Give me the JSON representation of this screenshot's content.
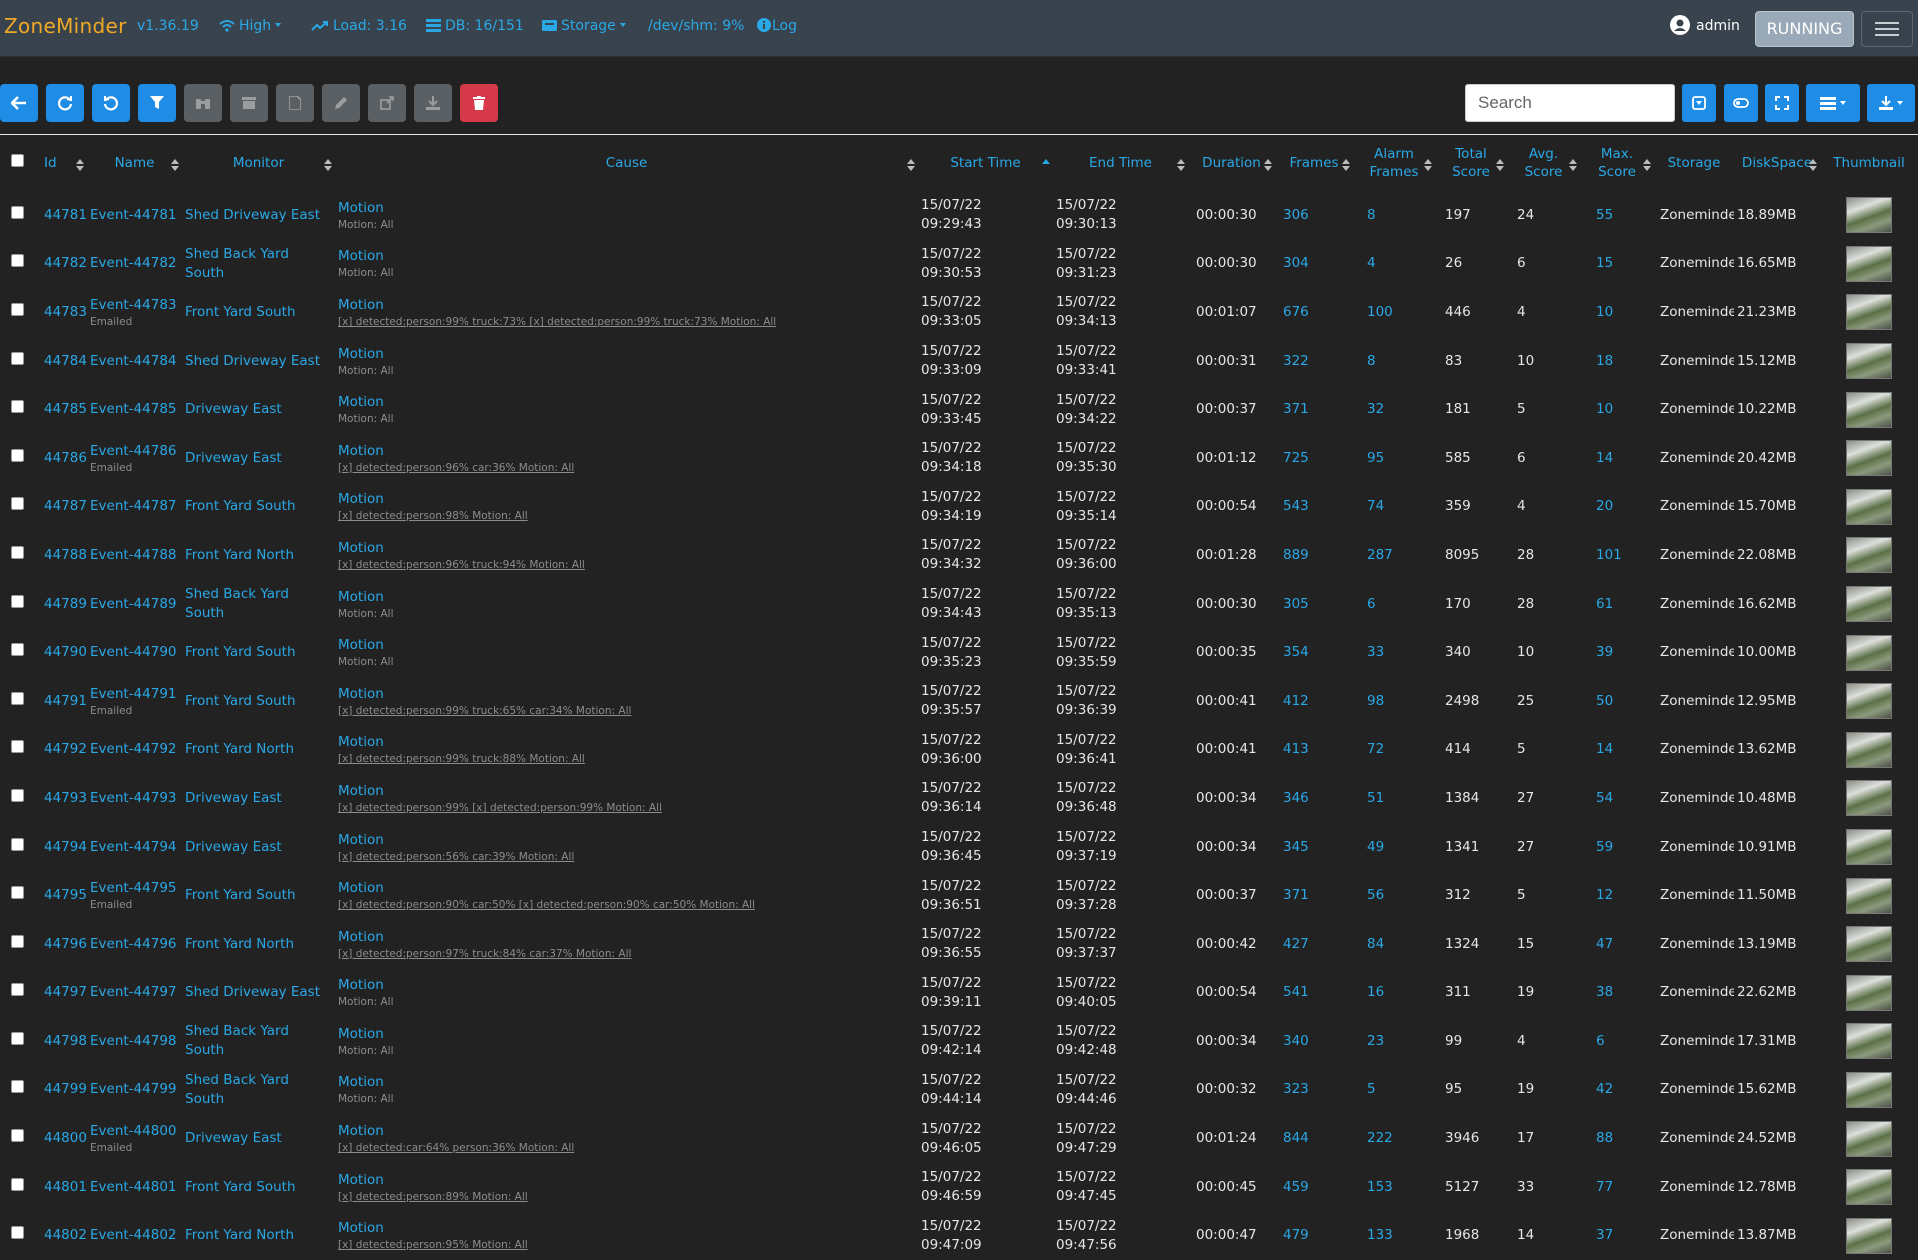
{
  "header": {
    "brand": "ZoneMinder",
    "version": "v1.36.19",
    "bandwidth": "High",
    "load": "Load: 3.16",
    "db": "DB: 16/151",
    "storage": "Storage",
    "shm": "/dev/shm: 9%",
    "log": "Log",
    "user": "admin",
    "state": "RUNNING"
  },
  "search": {
    "placeholder": "Search"
  },
  "columns": {
    "id": "Id",
    "name": "Name",
    "monitor": "Monitor",
    "cause": "Cause",
    "start_time": "Start Time",
    "end_time": "End Time",
    "duration": "Duration",
    "frames": "Frames",
    "alarm_frames": [
      "Alarm",
      "Frames"
    ],
    "total_score": [
      "Total",
      "Score"
    ],
    "avg_score": [
      "Avg.",
      "Score"
    ],
    "max_score": [
      "Max.",
      "Score"
    ],
    "storage": "Storage",
    "diskspace": "DiskSpace",
    "thumbnail": "Thumbnail"
  },
  "colors": {
    "accent": "#2aa8e6",
    "brand": "#f0a825",
    "navbar": "#39434d",
    "background": "#222222",
    "delete": "#d63a4a"
  },
  "rows": [
    {
      "id": "44781",
      "name": "Event-44781",
      "emailed": "",
      "monitor": "Shed Driveway East",
      "cause": "Motion",
      "notes": "Motion: All",
      "notes_link": false,
      "start_date": "15/07/22",
      "start_time": "09:29:43",
      "end_date": "15/07/22",
      "end_time": "09:30:13",
      "duration": "00:00:30",
      "frames": "306",
      "alarm_frames": "8",
      "total_score": "197",
      "avg_score": "24",
      "max_score": "55",
      "storage": "Zoneminder",
      "disk": "18.89MB"
    },
    {
      "id": "44782",
      "name": "Event-44782",
      "emailed": "",
      "monitor": "Shed Back Yard South",
      "cause": "Motion",
      "notes": "Motion: All",
      "notes_link": false,
      "start_date": "15/07/22",
      "start_time": "09:30:53",
      "end_date": "15/07/22",
      "end_time": "09:31:23",
      "duration": "00:00:30",
      "frames": "304",
      "alarm_frames": "4",
      "total_score": "26",
      "avg_score": "6",
      "max_score": "15",
      "storage": "Zoneminder",
      "disk": "16.65MB"
    },
    {
      "id": "44783",
      "name": "Event-44783",
      "emailed": "Emailed",
      "monitor": "Front Yard South",
      "cause": "Motion",
      "notes": "[x] detected:person:99% truck:73% [x] detected:person:99% truck:73% Motion: All",
      "notes_link": true,
      "start_date": "15/07/22",
      "start_time": "09:33:05",
      "end_date": "15/07/22",
      "end_time": "09:34:13",
      "duration": "00:01:07",
      "frames": "676",
      "alarm_frames": "100",
      "total_score": "446",
      "avg_score": "4",
      "max_score": "10",
      "storage": "Zoneminder",
      "disk": "21.23MB"
    },
    {
      "id": "44784",
      "name": "Event-44784",
      "emailed": "",
      "monitor": "Shed Driveway East",
      "cause": "Motion",
      "notes": "Motion: All",
      "notes_link": false,
      "start_date": "15/07/22",
      "start_time": "09:33:09",
      "end_date": "15/07/22",
      "end_time": "09:33:41",
      "duration": "00:00:31",
      "frames": "322",
      "alarm_frames": "8",
      "total_score": "83",
      "avg_score": "10",
      "max_score": "18",
      "storage": "Zoneminder",
      "disk": "15.12MB"
    },
    {
      "id": "44785",
      "name": "Event-44785",
      "emailed": "",
      "monitor": "Driveway East",
      "cause": "Motion",
      "notes": "Motion: All",
      "notes_link": false,
      "start_date": "15/07/22",
      "start_time": "09:33:45",
      "end_date": "15/07/22",
      "end_time": "09:34:22",
      "duration": "00:00:37",
      "frames": "371",
      "alarm_frames": "32",
      "total_score": "181",
      "avg_score": "5",
      "max_score": "10",
      "storage": "Zoneminder",
      "disk": "10.22MB"
    },
    {
      "id": "44786",
      "name": "Event-44786",
      "emailed": "Emailed",
      "monitor": "Driveway East",
      "cause": "Motion",
      "notes": "[x] detected:person:96% car:36% Motion: All",
      "notes_link": true,
      "start_date": "15/07/22",
      "start_time": "09:34:18",
      "end_date": "15/07/22",
      "end_time": "09:35:30",
      "duration": "00:01:12",
      "frames": "725",
      "alarm_frames": "95",
      "total_score": "585",
      "avg_score": "6",
      "max_score": "14",
      "storage": "Zoneminder",
      "disk": "20.42MB"
    },
    {
      "id": "44787",
      "name": "Event-44787",
      "emailed": "",
      "monitor": "Front Yard South",
      "cause": "Motion",
      "notes": "[x] detected:person:98% Motion: All",
      "notes_link": true,
      "start_date": "15/07/22",
      "start_time": "09:34:19",
      "end_date": "15/07/22",
      "end_time": "09:35:14",
      "duration": "00:00:54",
      "frames": "543",
      "alarm_frames": "74",
      "total_score": "359",
      "avg_score": "4",
      "max_score": "20",
      "storage": "Zoneminder",
      "disk": "15.70MB"
    },
    {
      "id": "44788",
      "name": "Event-44788",
      "emailed": "",
      "monitor": "Front Yard North",
      "cause": "Motion",
      "notes": "[x] detected:person:96% truck:94% Motion: All",
      "notes_link": true,
      "start_date": "15/07/22",
      "start_time": "09:34:32",
      "end_date": "15/07/22",
      "end_time": "09:36:00",
      "duration": "00:01:28",
      "frames": "889",
      "alarm_frames": "287",
      "total_score": "8095",
      "avg_score": "28",
      "max_score": "101",
      "storage": "Zoneminder",
      "disk": "22.08MB"
    },
    {
      "id": "44789",
      "name": "Event-44789",
      "emailed": "",
      "monitor": "Shed Back Yard South",
      "cause": "Motion",
      "notes": "Motion: All",
      "notes_link": false,
      "start_date": "15/07/22",
      "start_time": "09:34:43",
      "end_date": "15/07/22",
      "end_time": "09:35:13",
      "duration": "00:00:30",
      "frames": "305",
      "alarm_frames": "6",
      "total_score": "170",
      "avg_score": "28",
      "max_score": "61",
      "storage": "Zoneminder",
      "disk": "16.62MB"
    },
    {
      "id": "44790",
      "name": "Event-44790",
      "emailed": "",
      "monitor": "Front Yard South",
      "cause": "Motion",
      "notes": "Motion: All",
      "notes_link": false,
      "start_date": "15/07/22",
      "start_time": "09:35:23",
      "end_date": "15/07/22",
      "end_time": "09:35:59",
      "duration": "00:00:35",
      "frames": "354",
      "alarm_frames": "33",
      "total_score": "340",
      "avg_score": "10",
      "max_score": "39",
      "storage": "Zoneminder",
      "disk": "10.00MB"
    },
    {
      "id": "44791",
      "name": "Event-44791",
      "emailed": "Emailed",
      "monitor": "Front Yard South",
      "cause": "Motion",
      "notes": "[x] detected:person:99% truck:65% car:34% Motion: All",
      "notes_link": true,
      "start_date": "15/07/22",
      "start_time": "09:35:57",
      "end_date": "15/07/22",
      "end_time": "09:36:39",
      "duration": "00:00:41",
      "frames": "412",
      "alarm_frames": "98",
      "total_score": "2498",
      "avg_score": "25",
      "max_score": "50",
      "storage": "Zoneminder",
      "disk": "12.95MB"
    },
    {
      "id": "44792",
      "name": "Event-44792",
      "emailed": "",
      "monitor": "Front Yard North",
      "cause": "Motion",
      "notes": "[x] detected:person:99% truck:88% Motion: All",
      "notes_link": true,
      "start_date": "15/07/22",
      "start_time": "09:36:00",
      "end_date": "15/07/22",
      "end_time": "09:36:41",
      "duration": "00:00:41",
      "frames": "413",
      "alarm_frames": "72",
      "total_score": "414",
      "avg_score": "5",
      "max_score": "14",
      "storage": "Zoneminder",
      "disk": "13.62MB"
    },
    {
      "id": "44793",
      "name": "Event-44793",
      "emailed": "",
      "monitor": "Driveway East",
      "cause": "Motion",
      "notes": "[x] detected:person:99% [x] detected:person:99% Motion: All",
      "notes_link": true,
      "start_date": "15/07/22",
      "start_time": "09:36:14",
      "end_date": "15/07/22",
      "end_time": "09:36:48",
      "duration": "00:00:34",
      "frames": "346",
      "alarm_frames": "51",
      "total_score": "1384",
      "avg_score": "27",
      "max_score": "54",
      "storage": "Zoneminder",
      "disk": "10.48MB"
    },
    {
      "id": "44794",
      "name": "Event-44794",
      "emailed": "",
      "monitor": "Driveway East",
      "cause": "Motion",
      "notes": "[x] detected:person:56% car:39% Motion: All",
      "notes_link": true,
      "start_date": "15/07/22",
      "start_time": "09:36:45",
      "end_date": "15/07/22",
      "end_time": "09:37:19",
      "duration": "00:00:34",
      "frames": "345",
      "alarm_frames": "49",
      "total_score": "1341",
      "avg_score": "27",
      "max_score": "59",
      "storage": "Zoneminder",
      "disk": "10.91MB"
    },
    {
      "id": "44795",
      "name": "Event-44795",
      "emailed": "Emailed",
      "monitor": "Front Yard South",
      "cause": "Motion",
      "notes": "[x] detected:person:90% car:50% [x] detected:person:90% car:50% Motion: All",
      "notes_link": true,
      "start_date": "15/07/22",
      "start_time": "09:36:51",
      "end_date": "15/07/22",
      "end_time": "09:37:28",
      "duration": "00:00:37",
      "frames": "371",
      "alarm_frames": "56",
      "total_score": "312",
      "avg_score": "5",
      "max_score": "12",
      "storage": "Zoneminder",
      "disk": "11.50MB"
    },
    {
      "id": "44796",
      "name": "Event-44796",
      "emailed": "",
      "monitor": "Front Yard North",
      "cause": "Motion",
      "notes": "[x] detected:person:97% truck:84% car:37% Motion: All",
      "notes_link": true,
      "start_date": "15/07/22",
      "start_time": "09:36:55",
      "end_date": "15/07/22",
      "end_time": "09:37:37",
      "duration": "00:00:42",
      "frames": "427",
      "alarm_frames": "84",
      "total_score": "1324",
      "avg_score": "15",
      "max_score": "47",
      "storage": "Zoneminder",
      "disk": "13.19MB"
    },
    {
      "id": "44797",
      "name": "Event-44797",
      "emailed": "",
      "monitor": "Shed Driveway East",
      "cause": "Motion",
      "notes": "Motion: All",
      "notes_link": false,
      "start_date": "15/07/22",
      "start_time": "09:39:11",
      "end_date": "15/07/22",
      "end_time": "09:40:05",
      "duration": "00:00:54",
      "frames": "541",
      "alarm_frames": "16",
      "total_score": "311",
      "avg_score": "19",
      "max_score": "38",
      "storage": "Zoneminder",
      "disk": "22.62MB"
    },
    {
      "id": "44798",
      "name": "Event-44798",
      "emailed": "",
      "monitor": "Shed Back Yard South",
      "cause": "Motion",
      "notes": "Motion: All",
      "notes_link": false,
      "start_date": "15/07/22",
      "start_time": "09:42:14",
      "end_date": "15/07/22",
      "end_time": "09:42:48",
      "duration": "00:00:34",
      "frames": "340",
      "alarm_frames": "23",
      "total_score": "99",
      "avg_score": "4",
      "max_score": "6",
      "storage": "Zoneminder",
      "disk": "17.31MB"
    },
    {
      "id": "44799",
      "name": "Event-44799",
      "emailed": "",
      "monitor": "Shed Back Yard South",
      "cause": "Motion",
      "notes": "Motion: All",
      "notes_link": false,
      "start_date": "15/07/22",
      "start_time": "09:44:14",
      "end_date": "15/07/22",
      "end_time": "09:44:46",
      "duration": "00:00:32",
      "frames": "323",
      "alarm_frames": "5",
      "total_score": "95",
      "avg_score": "19",
      "max_score": "42",
      "storage": "Zoneminder",
      "disk": "15.62MB"
    },
    {
      "id": "44800",
      "name": "Event-44800",
      "emailed": "Emailed",
      "monitor": "Driveway East",
      "cause": "Motion",
      "notes": "[x] detected:car:64% person:36% Motion: All",
      "notes_link": true,
      "start_date": "15/07/22",
      "start_time": "09:46:05",
      "end_date": "15/07/22",
      "end_time": "09:47:29",
      "duration": "00:01:24",
      "frames": "844",
      "alarm_frames": "222",
      "total_score": "3946",
      "avg_score": "17",
      "max_score": "88",
      "storage": "Zoneminder",
      "disk": "24.52MB"
    },
    {
      "id": "44801",
      "name": "Event-44801",
      "emailed": "",
      "monitor": "Front Yard South",
      "cause": "Motion",
      "notes": "[x] detected:person:89% Motion: All",
      "notes_link": true,
      "start_date": "15/07/22",
      "start_time": "09:46:59",
      "end_date": "15/07/22",
      "end_time": "09:47:45",
      "duration": "00:00:45",
      "frames": "459",
      "alarm_frames": "153",
      "total_score": "5127",
      "avg_score": "33",
      "max_score": "77",
      "storage": "Zoneminder",
      "disk": "12.78MB"
    },
    {
      "id": "44802",
      "name": "Event-44802",
      "emailed": "",
      "monitor": "Front Yard North",
      "cause": "Motion",
      "notes": "[x] detected:person:95% Motion: All",
      "notes_link": true,
      "start_date": "15/07/22",
      "start_time": "09:47:09",
      "end_date": "15/07/22",
      "end_time": "09:47:56",
      "duration": "00:00:47",
      "frames": "479",
      "alarm_frames": "133",
      "total_score": "1968",
      "avg_score": "14",
      "max_score": "37",
      "storage": "Zoneminder",
      "disk": "13.87MB"
    }
  ]
}
